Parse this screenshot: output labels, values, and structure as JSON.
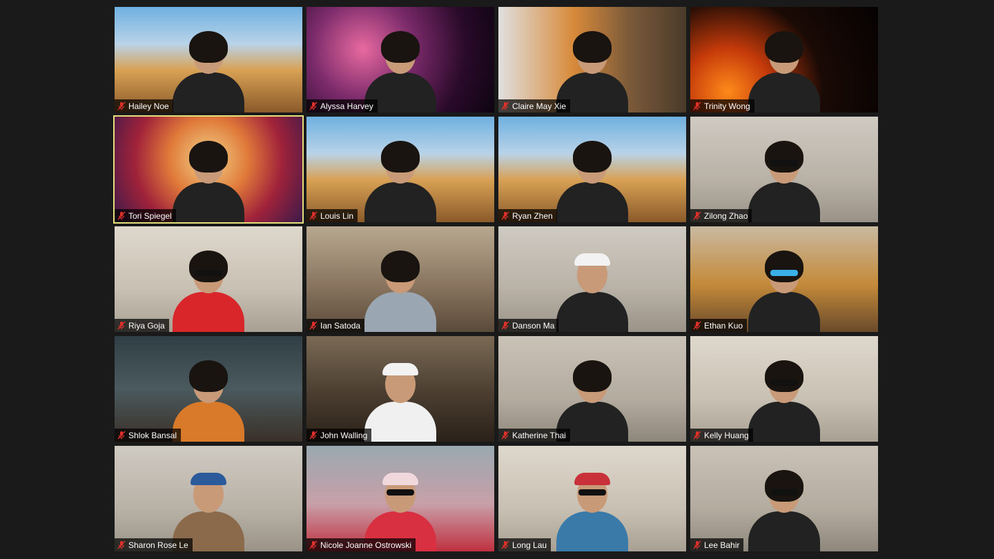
{
  "participants": [
    {
      "name": "Hailey Noe",
      "muted": true
    },
    {
      "name": "Alyssa Harvey",
      "muted": true
    },
    {
      "name": "Claire May Xie",
      "muted": true
    },
    {
      "name": "Trinity Wong",
      "muted": true
    },
    {
      "name": "Tori Spiegel",
      "muted": true,
      "active_speaker": true
    },
    {
      "name": "Louis Lin",
      "muted": true
    },
    {
      "name": "Ryan Zhen",
      "muted": true
    },
    {
      "name": "Zilong Zhao",
      "muted": true
    },
    {
      "name": "Riya Goja",
      "muted": true
    },
    {
      "name": "Ian Satoda",
      "muted": true
    },
    {
      "name": "Danson Ma",
      "muted": true
    },
    {
      "name": "Ethan Kuo",
      "muted": true
    },
    {
      "name": "Shlok Bansal",
      "muted": true
    },
    {
      "name": "John Walling",
      "muted": true
    },
    {
      "name": "Katherine Thai",
      "muted": true
    },
    {
      "name": "Kelly Huang",
      "muted": true
    },
    {
      "name": "Sharon Rose Le",
      "muted": true
    },
    {
      "name": "Nicole Joanne Ostrowski",
      "muted": true
    },
    {
      "name": "Long Lau",
      "muted": true
    },
    {
      "name": "Lee Bahir",
      "muted": true
    }
  ],
  "icons": {
    "muted": "muted-mic-icon"
  },
  "colors": {
    "background": "#1a1a1a",
    "active_speaker_border": "#e6e07a",
    "muted_icon": "#e0302a"
  }
}
